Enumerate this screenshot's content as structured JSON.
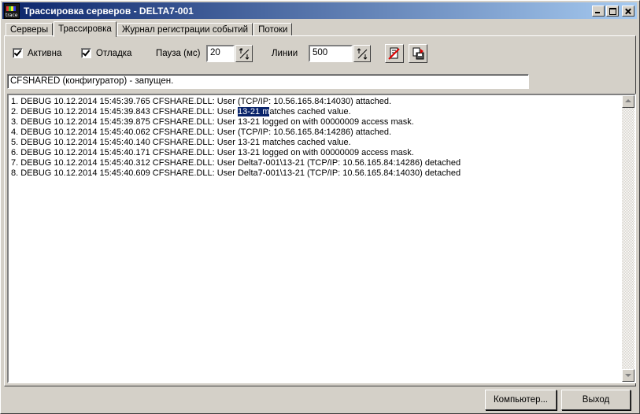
{
  "window": {
    "title": "Трассировка серверов - DELTA7-001",
    "icon_label": "trace"
  },
  "tabs": [
    {
      "label": "Серверы",
      "active": false
    },
    {
      "label": "Трассировка",
      "active": true
    },
    {
      "label": "Журнал регистрации событий",
      "active": false
    },
    {
      "label": "Потоки",
      "active": false
    }
  ],
  "controls": {
    "active_label": "Активна",
    "active_checked": true,
    "debug_label": "Отладка",
    "debug_checked": true,
    "pause_label": "Пауза (мс)",
    "pause_value": "20",
    "lines_label": "Линии",
    "lines_value": "500"
  },
  "status": "CFSHARED (конфигуратор)  - запущен.",
  "log": [
    {
      "text": "1. DEBUG  10.12.2014  15:45:39.765 CFSHARE.DLL: User  (TCP/IP: 10.56.165.84:14030) attached."
    },
    {
      "pre": "2. DEBUG  10.12.2014  15:45:39.843 CFSHARE.DLL: User ",
      "sel": "13-21 m",
      "post": "atches cached value."
    },
    {
      "text": "3. DEBUG  10.12.2014  15:45:39.875 CFSHARE.DLL: User 13-21 logged on with 00000009 access mask."
    },
    {
      "text": "4. DEBUG  10.12.2014  15:45:40.062 CFSHARE.DLL: User  (TCP/IP: 10.56.165.84:14286) attached."
    },
    {
      "text": "5. DEBUG  10.12.2014  15:45:40.140 CFSHARE.DLL: User 13-21 matches cached value."
    },
    {
      "text": "6. DEBUG  10.12.2014  15:45:40.171 CFSHARE.DLL: User 13-21 logged on with 00000009 access mask."
    },
    {
      "text": "7. DEBUG  10.12.2014  15:45:40.312 CFSHARE.DLL: User Delta7-001\\13-21 (TCP/IP: 10.56.165.84:14286) detached"
    },
    {
      "text": "8. DEBUG  10.12.2014  15:45:40.609 CFSHARE.DLL: User Delta7-001\\13-21 (TCP/IP: 10.56.165.84:14030) detached"
    }
  ],
  "buttons": {
    "computer": "Компьютер...",
    "exit": "Выход"
  },
  "colors": {
    "titlebar_start": "#0a246a",
    "titlebar_end": "#a6caf0",
    "face": "#d4d0c8",
    "selection": "#0a246a"
  }
}
